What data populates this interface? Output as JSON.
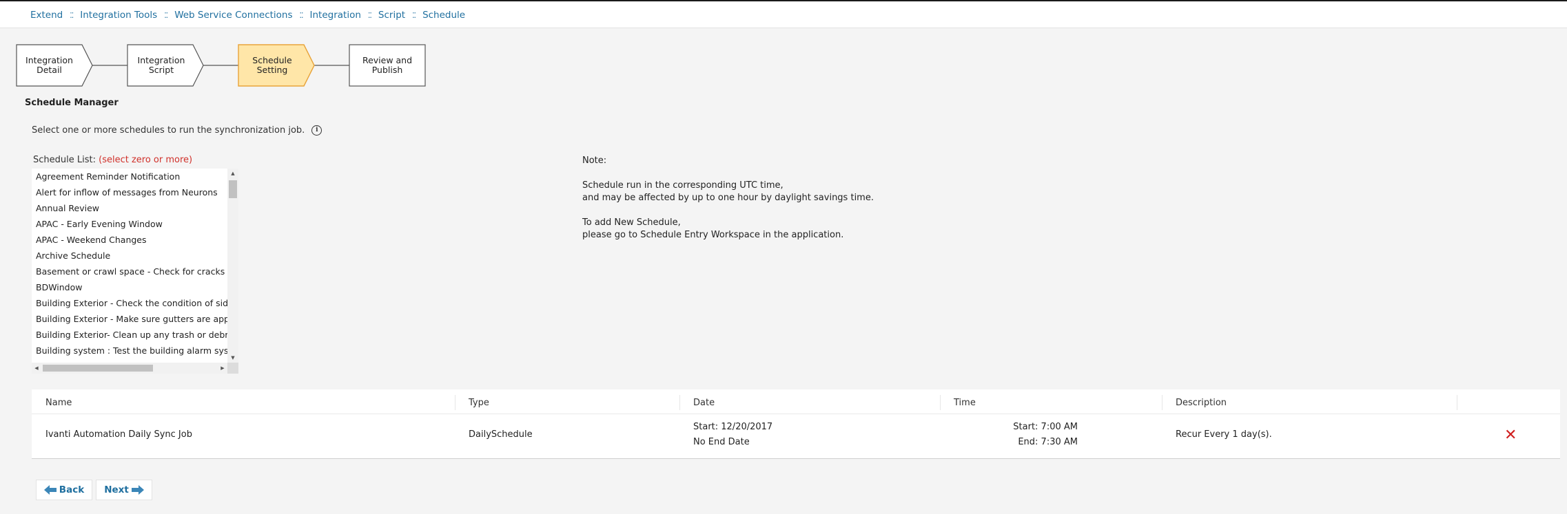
{
  "breadcrumb": {
    "items": [
      "Extend",
      "Integration Tools",
      "Web Service Connections",
      "Integration",
      "Script",
      "Schedule"
    ]
  },
  "wizard": {
    "steps": [
      {
        "line1": "Integration",
        "line2": "Detail"
      },
      {
        "line1": "Integration",
        "line2": "Script"
      },
      {
        "line1": "Schedule",
        "line2": "Setting"
      },
      {
        "line1": "Review and",
        "line2": "Publish"
      }
    ],
    "active_step": 3,
    "active_fill": "#ffe6a8",
    "active_stroke": "#e8a33a"
  },
  "schedule_manager": {
    "title": "Schedule Manager",
    "intro": "Select one or more schedules to run the synchronization job.",
    "list_label": "Schedule List:",
    "list_hint": "(select zero or more)",
    "items": [
      "Agreement Reminder Notification",
      "Alert for inflow of messages from Neurons",
      "Annual Review",
      "APAC - Early Evening Window",
      "APAC - Weekend Changes",
      "Archive Schedule",
      "Basement or crawl space - Check for cracks or any",
      "BDWindow",
      "Building Exterior - Check the condition of sidewalk",
      "Building Exterior - Make sure gutters are appropri",
      "Building Exterior- Clean up any trash or debris on",
      "Building system : Test the building alarm system, l"
    ]
  },
  "note": {
    "heading": "Note:",
    "line1": "Schedule run in the corresponding UTC time,",
    "line2": "and may be affected by up to one hour by daylight savings time.",
    "line3": "To add New Schedule,",
    "line4": "please go to Schedule Entry Workspace in the application."
  },
  "grid": {
    "headers": {
      "name": "Name",
      "type": "Type",
      "date": "Date",
      "time": "Time",
      "description": "Description"
    },
    "rows": [
      {
        "name": "Ivanti Automation Daily Sync Job",
        "type": "DailySchedule",
        "date_start": "Start: 12/20/2017",
        "date_end": "No End Date",
        "time_start": "Start: 7:00 AM",
        "time_end": "End: 7:30 AM",
        "description": "Recur Every 1 day(s)."
      }
    ]
  },
  "buttons": {
    "back": "Back",
    "next": "Next"
  }
}
